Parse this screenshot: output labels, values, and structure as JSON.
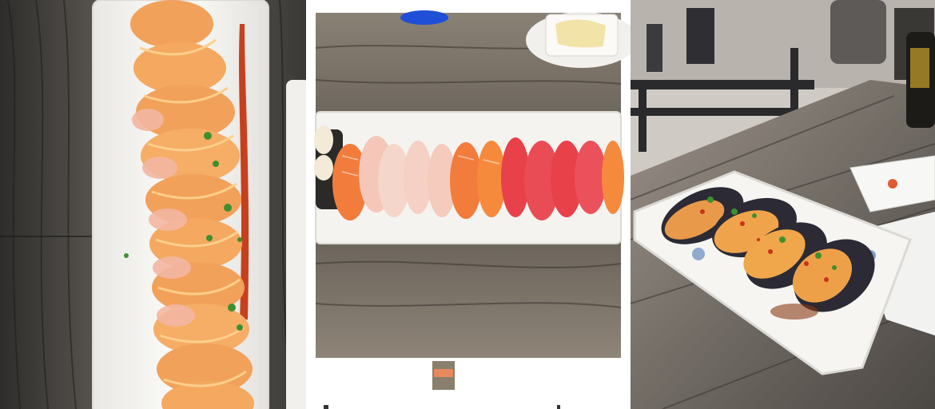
{
  "images": [
    {
      "subject": "sushi-roll-platter"
    },
    {
      "subject": "nigiri-platter"
    },
    {
      "subject": "baked-mussels"
    }
  ],
  "colors": {
    "wood_dark": "#3b3a38",
    "wood_light": "#7b756d",
    "plate": "#f4f3f0",
    "salmon": "#f27c3c",
    "tuna": "#e8414a",
    "sauce": "#f0a64a",
    "mussel_shell": "#2b2a35"
  }
}
